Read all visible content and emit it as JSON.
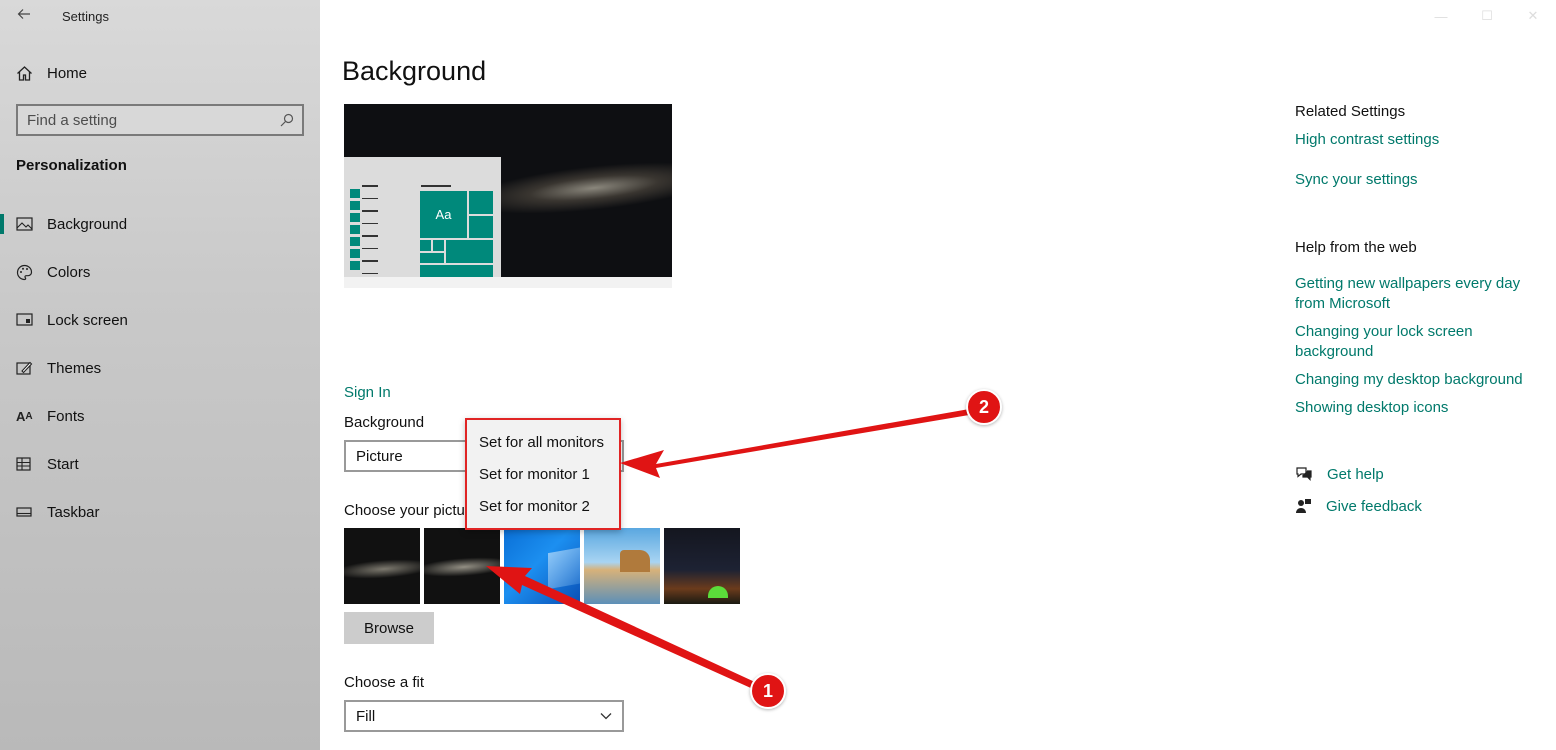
{
  "titlebar": {
    "title": "Settings",
    "back_icon": "back-arrow-icon"
  },
  "sidebar": {
    "home_label": "Home",
    "search_placeholder": "Find a setting",
    "section_title": "Personalization",
    "items": [
      {
        "label": "Background",
        "icon": "picture-icon",
        "active": true
      },
      {
        "label": "Colors",
        "icon": "palette-icon"
      },
      {
        "label": "Lock screen",
        "icon": "lock-screen-icon"
      },
      {
        "label": "Themes",
        "icon": "themes-icon"
      },
      {
        "label": "Fonts",
        "icon": "fonts-icon"
      },
      {
        "label": "Start",
        "icon": "start-icon"
      },
      {
        "label": "Taskbar",
        "icon": "taskbar-icon"
      }
    ]
  },
  "main": {
    "title": "Background",
    "preview_tile_label": "Aa",
    "sign_in": "Sign In",
    "background_label": "Background",
    "background_value": "Picture",
    "choose_picture_label": "Choose your pictu",
    "browse_label": "Browse",
    "fit_label": "Choose a fit",
    "fit_value": "Fill",
    "context_menu": [
      "Set for all monitors",
      "Set for monitor 1",
      "Set for monitor 2"
    ]
  },
  "related": {
    "related_heading": "Related Settings",
    "high_contrast": "High contrast settings",
    "sync": "Sync your settings",
    "help_heading": "Help from the web",
    "links": [
      "Getting new wallpapers every day from Microsoft",
      "Changing your lock screen background",
      "Changing my desktop background",
      "Showing desktop icons"
    ],
    "get_help": "Get help",
    "give_feedback": "Give feedback"
  },
  "annotations": {
    "badge_1": "1",
    "badge_2": "2"
  },
  "colors": {
    "accent": "#00796b",
    "annotation_red": "#e01414",
    "sidebar_bg": "#c9c9c9"
  }
}
